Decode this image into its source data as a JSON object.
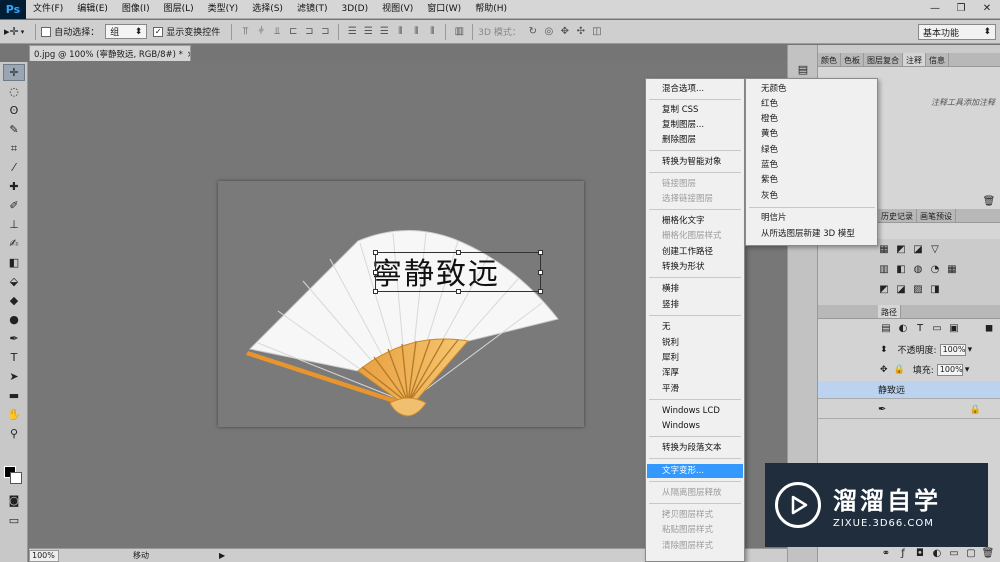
{
  "app": {
    "logo": "Ps"
  },
  "menu": [
    "文件(F)",
    "编辑(E)",
    "图像(I)",
    "图层(L)",
    "类型(Y)",
    "选择(S)",
    "滤镜(T)",
    "3D(D)",
    "视图(V)",
    "窗口(W)",
    "帮助(H)"
  ],
  "options": {
    "auto_select_label": "自动选择：",
    "auto_select_value": "组",
    "show_transform_label": "显示变换控件",
    "mode_3d_label": "3D 模式：",
    "workspace": "基本功能"
  },
  "document": {
    "tab_title": "0.jpg @ 100% (寧静致远, RGB/8#) *",
    "close": "×",
    "canvas_text": "寧静致远"
  },
  "status": {
    "zoom": "100%",
    "text": "移动"
  },
  "panels": {
    "top_tabs": [
      "颜色",
      "色板",
      "图层复合",
      "注释",
      "信息"
    ],
    "active_top_tab": "注释",
    "notes_hint": "注释工具添加注释",
    "mid_tabs": [
      "历史记录",
      "画笔预设"
    ],
    "layers_tab": "路径",
    "opacity_label": "不透明度:",
    "opacity_value": "100%",
    "fill_label": "填充:",
    "fill_value": "100%",
    "layers": [
      "静致远",
      ""
    ]
  },
  "context_menu": [
    {
      "label": "混合选项...",
      "state": "normal"
    },
    {
      "label": "复制 CSS",
      "state": "normal"
    },
    {
      "label": "复制图层...",
      "state": "normal"
    },
    {
      "label": "删除图层",
      "state": "normal"
    },
    {
      "label": "转换为智能对象",
      "state": "normal"
    },
    {
      "label": "链接图层",
      "state": "disabled"
    },
    {
      "label": "选择链接图层",
      "state": "disabled"
    },
    {
      "label": "栅格化文字",
      "state": "normal"
    },
    {
      "label": "栅格化图层样式",
      "state": "disabled"
    },
    {
      "label": "创建工作路径",
      "state": "normal"
    },
    {
      "label": "转换为形状",
      "state": "normal"
    },
    {
      "label": "横排",
      "state": "normal"
    },
    {
      "label": "竖排",
      "state": "normal"
    },
    {
      "label": "无",
      "state": "normal"
    },
    {
      "label": "锐利",
      "state": "normal"
    },
    {
      "label": "犀利",
      "state": "normal"
    },
    {
      "label": "浑厚",
      "state": "normal"
    },
    {
      "label": "平滑",
      "state": "normal"
    },
    {
      "label": "Windows LCD",
      "state": "normal"
    },
    {
      "label": "Windows",
      "state": "normal"
    },
    {
      "label": "转换为段落文本",
      "state": "normal"
    },
    {
      "label": "文字变形...",
      "state": "highlighted"
    },
    {
      "label": "从隔离图层释放",
      "state": "disabled"
    },
    {
      "label": "拷贝图层样式",
      "state": "disabled"
    },
    {
      "label": "粘贴图层样式",
      "state": "disabled"
    },
    {
      "label": "清除图层样式",
      "state": "disabled"
    }
  ],
  "submenu": [
    "无颜色",
    "红色",
    "橙色",
    "黄色",
    "绿色",
    "蓝色",
    "紫色",
    "灰色",
    "明信片",
    "从所选图层新建 3D 模型"
  ],
  "watermark": {
    "title": "溜溜自学",
    "url": "ZIXUE.3D66.COM"
  },
  "colors": {
    "highlight": "#3399ff",
    "ps_logo_bg": "#001d34",
    "ps_logo_fg": "#31a8ff",
    "watermark_bg": "#1f2d3d"
  }
}
